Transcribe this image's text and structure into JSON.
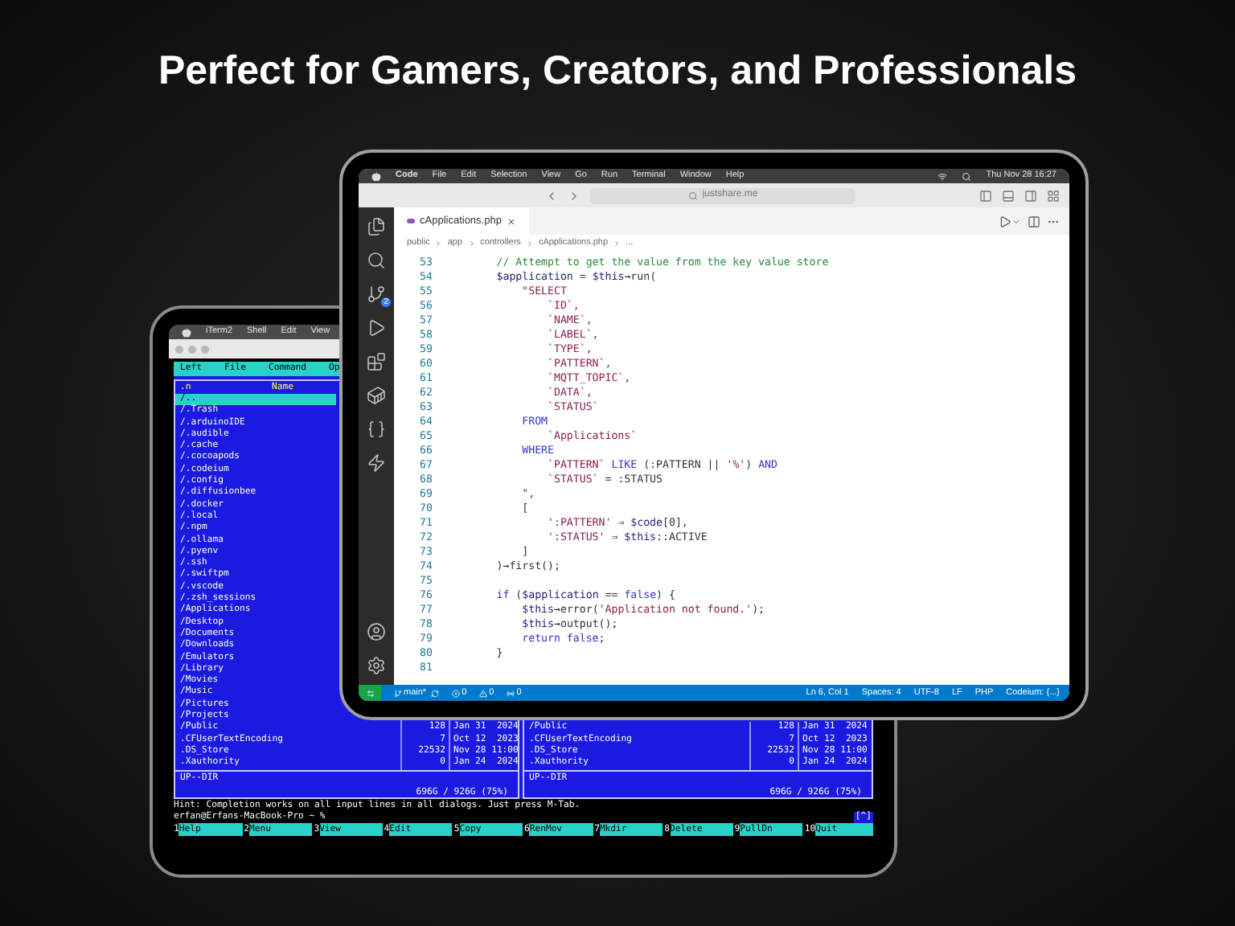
{
  "headline": "Perfect for Gamers, Creators, and Professionals",
  "terminal_device": {
    "menubar": [
      "iTerm2",
      "Shell",
      "Edit",
      "View"
    ],
    "mc_menu": [
      "Left",
      "File",
      "Command",
      "Op"
    ],
    "left_panel": {
      "columns": [
        ".n",
        "Name"
      ],
      "rows": [
        {
          "name": "/..",
          "selected": true
        },
        {
          "name": "/.Trash",
          "selected": false
        },
        {
          "name": "/.arduinoIDE",
          "selected": false
        },
        {
          "name": "/.audible",
          "selected": false
        },
        {
          "name": "/.cache",
          "selected": false
        },
        {
          "name": "/.cocoapods",
          "selected": false
        },
        {
          "name": "/.codeium",
          "selected": false
        },
        {
          "name": "/.config",
          "selected": false
        },
        {
          "name": "/.diffusionbee",
          "selected": false
        },
        {
          "name": "/.docker",
          "selected": false
        },
        {
          "name": "/.local",
          "selected": false
        },
        {
          "name": "/.npm",
          "selected": false
        },
        {
          "name": "/.ollama",
          "selected": false
        },
        {
          "name": "/.pyenv",
          "selected": false
        },
        {
          "name": "/.ssh",
          "selected": false
        },
        {
          "name": "/.swiftpm",
          "selected": false
        },
        {
          "name": "/.vscode",
          "selected": false
        },
        {
          "name": "/.zsh_sessions",
          "selected": false
        },
        {
          "name": "/Applications",
          "selected": false
        },
        {
          "name": "/Desktop",
          "selected": false
        },
        {
          "name": "/Documents",
          "selected": false
        },
        {
          "name": "/Downloads",
          "selected": false
        },
        {
          "name": "/Emulators",
          "selected": false
        },
        {
          "name": "/Library",
          "selected": false
        },
        {
          "name": "/Movies",
          "selected": false
        },
        {
          "name": "/Music",
          "selected": false
        },
        {
          "name": "/Pictures",
          "selected": false
        },
        {
          "name": "/Projects",
          "selected": false
        },
        {
          "name": "/Public",
          "size": "128",
          "date": "Jan 31  2024",
          "selected": false
        },
        {
          "name": ".CFUserTextEncoding",
          "size": "7",
          "date": "Oct 12  2023",
          "selected": false
        },
        {
          "name": ".DS_Store",
          "size": "22532",
          "date": "Nov 28 11:00",
          "selected": false
        },
        {
          "name": ".Xauthority",
          "size": "0",
          "date": "Jan 24  2024",
          "selected": false
        }
      ],
      "status": "UP--DIR",
      "disk": "696G / 926G (75%)"
    },
    "right_panel": {
      "rows": [
        {
          "name": "/Public",
          "size": "128",
          "date": "Jan 31  2024",
          "selected": false
        },
        {
          "name": ".CFUserTextEncoding",
          "size": "7",
          "date": "Oct 12  2023",
          "selected": false
        },
        {
          "name": ".DS_Store",
          "size": "22532",
          "date": "Nov 28 11:00",
          "selected": false
        },
        {
          "name": ".Xauthority",
          "size": "0",
          "date": "Jan 24  2024",
          "selected": false
        }
      ],
      "status": "UP--DIR",
      "disk": "696G / 926G (75%)"
    },
    "hint": "Hint: Completion works on all input lines in all dialogs. Just press M-Tab.",
    "prompt": "erfan@Erfans-MacBook-Pro ~ %",
    "corner": "[^]",
    "function_keys": [
      {
        "num": "1",
        "label": "Help"
      },
      {
        "num": "2",
        "label": "Menu"
      },
      {
        "num": "3",
        "label": "View"
      },
      {
        "num": "4",
        "label": "Edit"
      },
      {
        "num": "5",
        "label": "Copy"
      },
      {
        "num": "6",
        "label": "RenMov"
      },
      {
        "num": "7",
        "label": "Mkdir"
      },
      {
        "num": "8",
        "label": "Delete"
      },
      {
        "num": "9",
        "label": "PullDn"
      },
      {
        "num": "10",
        "label": "Quit"
      }
    ]
  },
  "editor_device": {
    "menubar": [
      "Code",
      "File",
      "Edit",
      "Selection",
      "View",
      "Go",
      "Run",
      "Terminal",
      "Window",
      "Help"
    ],
    "clock": "Thu Nov 28 16:27",
    "address": "justshare.me",
    "tab": {
      "label": "cApplications.php",
      "selected": true
    },
    "breadcrumb": [
      "public",
      "app",
      "controllers",
      "cApplications.php",
      "..."
    ],
    "scm_badge": "2",
    "code": [
      {
        "n": "53",
        "t": [
          {
            "kind": "c",
            "text": "        // Attempt to get the value from the key value store"
          }
        ]
      },
      {
        "n": "54",
        "t": [
          {
            "kind": "v",
            "text": "        $application"
          },
          {
            "kind": "p",
            "text": " = "
          },
          {
            "kind": "v",
            "text": "$this"
          },
          {
            "kind": "p",
            "text": "→run("
          }
        ]
      },
      {
        "n": "55",
        "t": [
          {
            "kind": "s",
            "text": "            \"SELECT"
          }
        ]
      },
      {
        "n": "56",
        "t": [
          {
            "kind": "s",
            "text": "                `ID`,"
          }
        ]
      },
      {
        "n": "57",
        "t": [
          {
            "kind": "s",
            "text": "                `NAME`,"
          }
        ]
      },
      {
        "n": "58",
        "t": [
          {
            "kind": "s",
            "text": "                `LABEL`,"
          }
        ]
      },
      {
        "n": "59",
        "t": [
          {
            "kind": "s",
            "text": "                `TYPE`,"
          }
        ]
      },
      {
        "n": "60",
        "t": [
          {
            "kind": "s",
            "text": "                `PATTERN`,"
          }
        ]
      },
      {
        "n": "61",
        "t": [
          {
            "kind": "s",
            "text": "                `MQTT_TOPIC`,"
          }
        ]
      },
      {
        "n": "62",
        "t": [
          {
            "kind": "s",
            "text": "                `DATA`,"
          }
        ]
      },
      {
        "n": "63",
        "t": [
          {
            "kind": "s",
            "text": "                `STATUS`"
          }
        ]
      },
      {
        "n": "64",
        "t": [
          {
            "kind": "k",
            "text": "            FROM"
          }
        ]
      },
      {
        "n": "65",
        "t": [
          {
            "kind": "s",
            "text": "                `Applications`"
          }
        ]
      },
      {
        "n": "66",
        "t": [
          {
            "kind": "k",
            "text": "            WHERE"
          }
        ]
      },
      {
        "n": "67",
        "t": [
          {
            "kind": "s",
            "text": "                `PATTERN`"
          },
          {
            "kind": "k",
            "text": " LIKE "
          },
          {
            "kind": "p",
            "text": "(:PATTERN || "
          },
          {
            "kind": "s",
            "text": "'%'"
          },
          {
            "kind": "p",
            "text": ") "
          },
          {
            "kind": "k",
            "text": "AND"
          }
        ]
      },
      {
        "n": "68",
        "t": [
          {
            "kind": "s",
            "text": "                `STATUS`"
          },
          {
            "kind": "p",
            "text": " = :STATUS"
          }
        ]
      },
      {
        "n": "69",
        "t": [
          {
            "kind": "s",
            "text": "            \","
          }
        ]
      },
      {
        "n": "70",
        "t": [
          {
            "kind": "p",
            "text": "            ["
          }
        ]
      },
      {
        "n": "71",
        "t": [
          {
            "kind": "s",
            "text": "                ':PATTERN'"
          },
          {
            "kind": "p",
            "text": " ⇒ "
          },
          {
            "kind": "v",
            "text": "$code"
          },
          {
            "kind": "p",
            "text": "[0],"
          }
        ]
      },
      {
        "n": "72",
        "t": [
          {
            "kind": "s",
            "text": "                ':STATUS'"
          },
          {
            "kind": "p",
            "text": " ⇒ "
          },
          {
            "kind": "v",
            "text": "$this"
          },
          {
            "kind": "p",
            "text": "::ACTIVE"
          }
        ]
      },
      {
        "n": "73",
        "t": [
          {
            "kind": "p",
            "text": "            ]"
          }
        ]
      },
      {
        "n": "74",
        "t": [
          {
            "kind": "p",
            "text": "        )→first();"
          }
        ]
      },
      {
        "n": "75"
      },
      {
        "n": "76",
        "t": [
          {
            "kind": "k",
            "text": "        if"
          },
          {
            "kind": "p",
            "text": " ("
          },
          {
            "kind": "v",
            "text": "$application"
          },
          {
            "kind": "p",
            "text": " == "
          },
          {
            "kind": "k",
            "text": "false"
          },
          {
            "kind": "p",
            "text": ") {"
          }
        ]
      },
      {
        "n": "77",
        "t": [
          {
            "kind": "v",
            "text": "            $this"
          },
          {
            "kind": "p",
            "text": "→error("
          },
          {
            "kind": "s",
            "text": "'Application not found.'"
          },
          {
            "kind": "p",
            "text": ");"
          }
        ]
      },
      {
        "n": "78",
        "t": [
          {
            "kind": "v",
            "text": "            $this"
          },
          {
            "kind": "p",
            "text": "→output();"
          }
        ]
      },
      {
        "n": "79",
        "t": [
          {
            "kind": "k",
            "text": "            return false"
          },
          {
            "kind": "p",
            "text": ";"
          }
        ]
      },
      {
        "n": "80",
        "t": [
          {
            "kind": "p",
            "text": "        }"
          }
        ]
      },
      {
        "n": "81"
      }
    ],
    "status_left": [
      {
        "kind": "branch",
        "text": "main*"
      },
      {
        "kind": "errors",
        "text": "0"
      },
      {
        "kind": "warnings",
        "text": "0"
      },
      {
        "kind": "ports",
        "text": "0"
      }
    ],
    "status_right": [
      "Ln 6, Col 1",
      "Spaces: 4",
      "UTF-8",
      "LF",
      "PHP",
      "Codeium: {...}"
    ]
  }
}
